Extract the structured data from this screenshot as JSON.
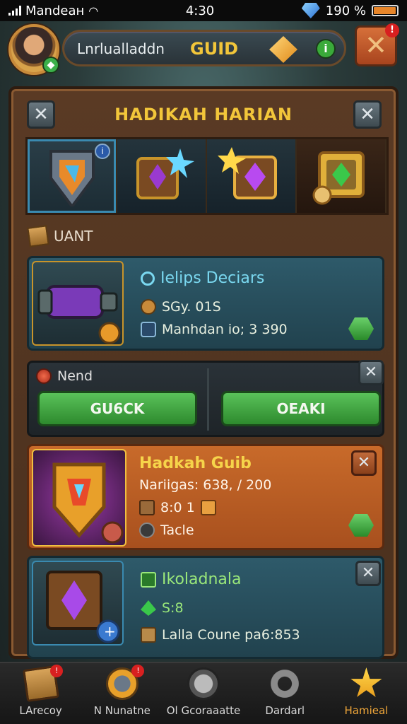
{
  "status": {
    "carrier": "Mandeaн",
    "time": "4:30",
    "battery": "190 %",
    "battery_level": 0.9
  },
  "header": {
    "player_name": "Lnrlualladdn",
    "guild_label": "GUID",
    "close_badge": "!"
  },
  "panel": {
    "title": "HADIKAH HARIAN",
    "section_label": "UANT",
    "item1": {
      "title": "Ielips Deciars",
      "line2": "SGy. 01S",
      "line3": "Manhdan io; 3 390"
    },
    "item2": {
      "label": "Nend",
      "button_left": "GU6CK",
      "button_right": "OEAKI"
    },
    "item3": {
      "title": "Hadkah Guib",
      "line2": "Nariigas: 638, / 200",
      "line3": "8:0 1",
      "line4": "Tacle"
    },
    "item4": {
      "title": "Ikoladnala",
      "line2": "S:8",
      "line3": "Lalla Coune pa6:853"
    }
  },
  "nav": [
    {
      "label": "LArecoy",
      "badge": "!"
    },
    {
      "label": "N Nunatne",
      "badge": "!"
    },
    {
      "label": "Ol Gcoraaatte",
      "badge": ""
    },
    {
      "label": "Dardarl",
      "badge": ""
    },
    {
      "label": "Hamieal",
      "badge": ""
    }
  ],
  "colors": {
    "gold": "#f2c63a",
    "green": "#3bb04a",
    "teal": "#2e5a6a",
    "orange": "#c86a2a"
  }
}
